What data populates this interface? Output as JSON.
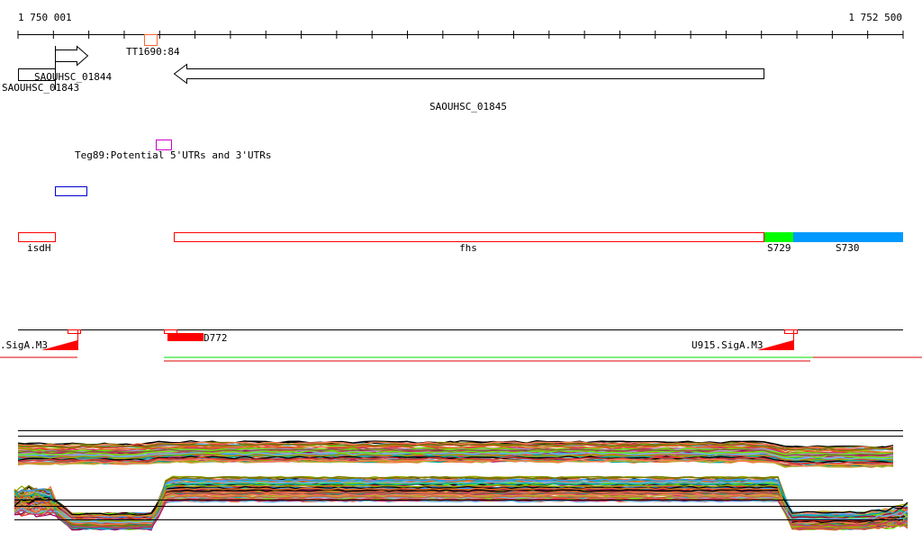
{
  "ruler": {
    "start_label": "1 750 001",
    "end_label": "1 752 500",
    "start": 1750001,
    "end": 1752500,
    "tick_step_bp": 100
  },
  "features": {
    "tt1690": {
      "label": "TT1690:84",
      "color": "#ff6633"
    },
    "gene_01844": {
      "label": "SAOUHSC_01844",
      "strand": "+"
    },
    "gene_01843": {
      "label": "SAOUHSC_01843"
    },
    "gene_01845": {
      "label": "SAOUHSC_01845",
      "strand": "-"
    },
    "teg89": {
      "label": "Teg89:Potential 5'UTRs and 3'UTRs",
      "color": "#cc00cc"
    },
    "blue_box": {
      "color": "#0000cc"
    },
    "isdH": {
      "label": "isdH",
      "color": "#ff0000"
    },
    "fhs": {
      "label": "fhs",
      "color": "#ff0000"
    },
    "s729": {
      "label": "S729",
      "color": "#00ff00"
    },
    "s730": {
      "label": "S730",
      "color": "#0099ff"
    }
  },
  "promoters": {
    "left": {
      "label": ".SigA.M3",
      "color": "#ff0000"
    },
    "middle": {
      "label": "D772",
      "color": "#ff0000"
    },
    "right": {
      "label": "U915.SigA.M3",
      "color": "#ff0000"
    }
  },
  "tracks": {
    "green": "#00dd00",
    "red": "#dd0000"
  },
  "expression": {
    "palette": [
      "#000000",
      "#cc6633",
      "#e07020",
      "#99aa00",
      "#66bbee",
      "#cc3366",
      "#aa99cc",
      "#777700",
      "#66ee00",
      "#dd3333",
      "#885544",
      "#ff7755",
      "#3399ff",
      "#990055",
      "#bbaa33",
      "#00aa99"
    ]
  }
}
